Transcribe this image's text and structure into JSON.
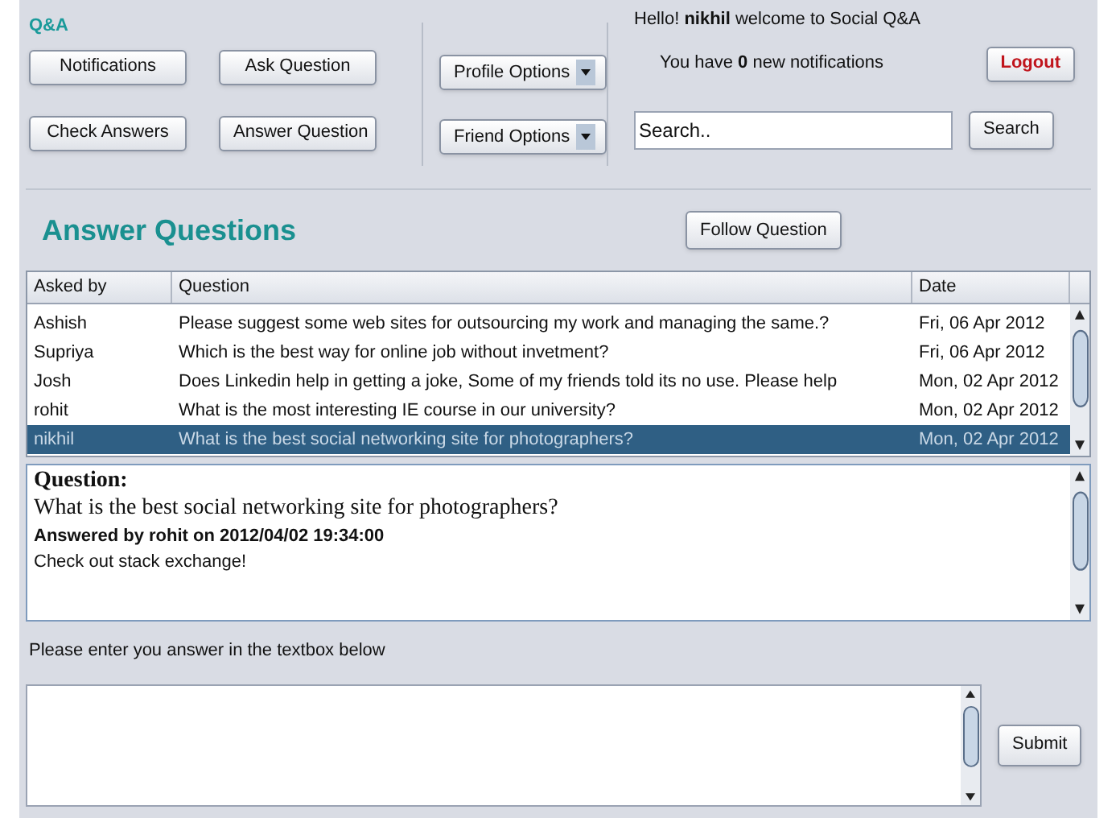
{
  "app_title": "Q&A",
  "nav_buttons": [
    "Notifications",
    "Ask Question",
    "Check Answers",
    "Answer Question"
  ],
  "dropdowns": [
    "Profile Options",
    "Friend Options"
  ],
  "greeting": "Hello! **nikhil** welcome to Social Q&A",
  "notifications_text": "You have **0** new notifications",
  "logout": "Logout",
  "search": {
    "value": "Search..",
    "button": "Search"
  },
  "heading": "Answer Questions",
  "follow_button": "Follow Question",
  "table": {
    "columns": [
      "Asked by",
      "Question",
      "Date"
    ],
    "rows": [
      {
        "cells": [
          "Ashish",
          "Please suggest some web sites for outsourcing my work and managing the same.?",
          "Fri, 06 Apr 2012"
        ],
        "selected": false
      },
      {
        "cells": [
          "Supriya",
          "Which is the best way for online job without invetment?",
          "Fri, 06 Apr 2012"
        ],
        "selected": false
      },
      {
        "cells": [
          "Josh",
          "Does Linkedin help in getting a joke, Some of my friends told its no use. Please help",
          "Mon, 02 Apr 2012"
        ],
        "selected": false
      },
      {
        "cells": [
          "rohit",
          "What is the most interesting IE course in  our university?",
          "Mon, 02 Apr 2012"
        ],
        "selected": false
      },
      {
        "cells": [
          "nikhil",
          "What is the best social networking site for photographers?",
          "Mon, 02 Apr 2012"
        ],
        "selected": true
      }
    ]
  },
  "detail": {
    "label": "Question:",
    "question": "What is the best social networking site for photographers?",
    "answered_by": "Answered by rohit on 2012/04/02 19:34:00",
    "answer": "Check out stack exchange!"
  },
  "answer_prompt": "Please enter you answer in the textbox below",
  "submit": "Submit"
}
